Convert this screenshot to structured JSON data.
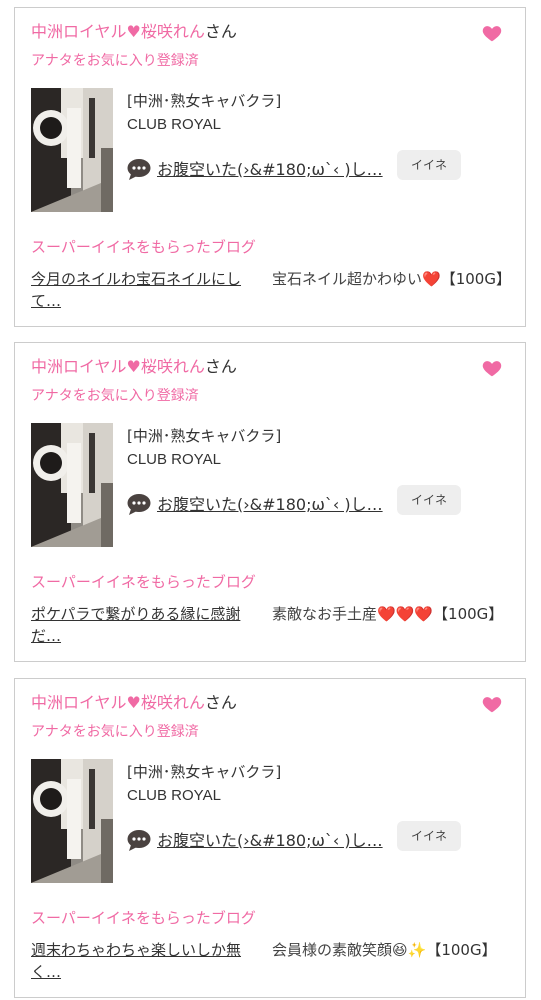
{
  "cards": [
    {
      "cast_name": "中洲ロイヤル♥桜咲れん",
      "honorific": "さん",
      "favorite_status": "アナタをお気に入り登録済",
      "shop_category": "[中洲･熟女キャバクラ]",
      "shop_name": "CLUB ROYAL",
      "latest_post": "お腹空いた(›&#180;ω`‹ )し…",
      "iine_label": "イイネ",
      "section_title": "スーパーイイネをもらったブログ",
      "blog_title": "今月のネイルわ宝石ネイルにして…",
      "blog_comment": "宝石ネイル超かわゆい❤️",
      "reward": "【100G】"
    },
    {
      "cast_name": "中洲ロイヤル♥桜咲れん",
      "honorific": "さん",
      "favorite_status": "アナタをお気に入り登録済",
      "shop_category": "[中洲･熟女キャバクラ]",
      "shop_name": "CLUB ROYAL",
      "latest_post": "お腹空いた(›&#180;ω`‹ )し…",
      "iine_label": "イイネ",
      "section_title": "スーパーイイネをもらったブログ",
      "blog_title": "ポケパラで繋がりある縁に感謝だ…",
      "blog_comment": "素敵なお手土産❤️❤️❤️",
      "reward": "【100G】"
    },
    {
      "cast_name": "中洲ロイヤル♥桜咲れん",
      "honorific": "さん",
      "favorite_status": "アナタをお気に入り登録済",
      "shop_category": "[中洲･熟女キャバクラ]",
      "shop_name": "CLUB ROYAL",
      "latest_post": "お腹空いた(›&#180;ω`‹ )し…",
      "iine_label": "イイネ",
      "section_title": "スーパーイイネをもらったブログ",
      "blog_title": "週末わちゃわちゃ楽しいしか無く…",
      "blog_comment": "会員様の素敵笑顔😆✨",
      "reward": "【100G】"
    }
  ],
  "colors": {
    "accent_pink": "#f06aa4",
    "border": "#cccccc",
    "button_bg": "#eeeeee"
  },
  "icons": {
    "favorite": "heart-icon",
    "comment": "speech-bubble-icon"
  }
}
